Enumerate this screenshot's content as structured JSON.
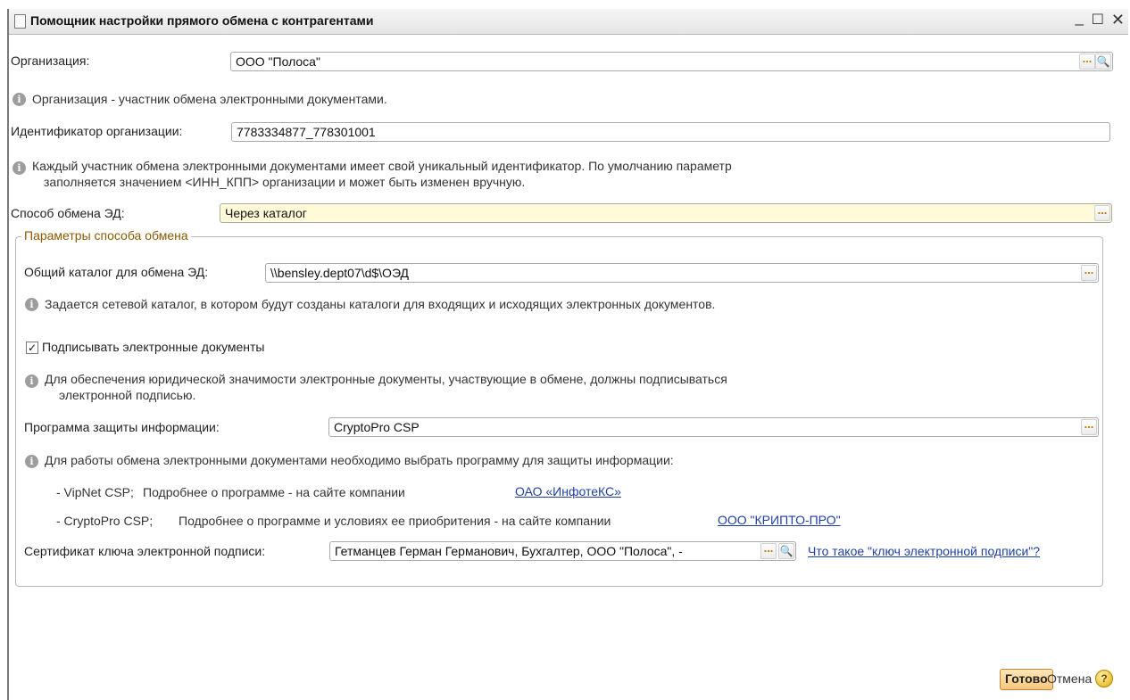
{
  "window": {
    "title": "Помощник настройки прямого обмена с контрагентами",
    "min_glyph": "_",
    "max_glyph": "☐",
    "close_glyph": "✕"
  },
  "organization": {
    "label": "Организация:",
    "value": "ООО \"Полоса\"",
    "info": "Организация - участник обмена электронными документами."
  },
  "org_id": {
    "label": "Идентификатор организации:",
    "value": "7783334877_778301001",
    "info_line1": "Каждый участник обмена электронными документами имеет свой уникальный идентификатор. По умолчанию параметр",
    "info_line2": "заполняется значением <ИНН_КПП> организации и может быть изменен вручную."
  },
  "exchange_method": {
    "label": "Способ обмена ЭД:",
    "value": "Через каталог"
  },
  "params_group": {
    "legend": "Параметры способа обмена",
    "catalog": {
      "label": "Общий каталог для обмена ЭД:",
      "value": "\\\\bensley.dept07\\d$\\ОЭД",
      "info": "Задается сетевой каталог, в котором будут созданы каталоги для входящих и исходящих электронных документов."
    },
    "sign": {
      "checked": true,
      "check_glyph": "✓",
      "label": "Подписывать электронные документы",
      "info_line1": "Для обеспечения юридической значимости электронные документы, участвующие в обмене, должны подписываться",
      "info_line2": "электронной подписью."
    },
    "protection": {
      "label": "Программа защиты информации:",
      "value": "CryptoPro CSP",
      "info": "Для работы обмена электронными документами необходимо выбрать программу для защиты информации:",
      "vipnet_prefix": "- VipNet CSP;",
      "vipnet_text": "Подробнее о программе - на сайте компании",
      "vipnet_link": "ОАО «ИнфотеКС»",
      "crypto_prefix": "- CryptoPro CSP;",
      "crypto_text": "Подробнее о программе и условиях ее приобритения - на сайте компании",
      "crypto_link": "ООО \"КРИПТО-ПРО\""
    },
    "certificate": {
      "label": "Сертификат ключа электронной подписи:",
      "value": "Гетманцев Герман Германович, Бухгалтер, ООО \"Полоса\", -",
      "link": "Что такое \"ключ электронной подписи\"?"
    }
  },
  "buttons": {
    "done": "Готово",
    "cancel": "Отмена",
    "help": "?"
  },
  "icons": {
    "ellipsis": "...",
    "magnifier": "🔍",
    "info": "i"
  },
  "colors": {
    "accent_link": "#1f3f9f",
    "legend": "#8a5a00",
    "highlight_field": "#fffbd8"
  }
}
